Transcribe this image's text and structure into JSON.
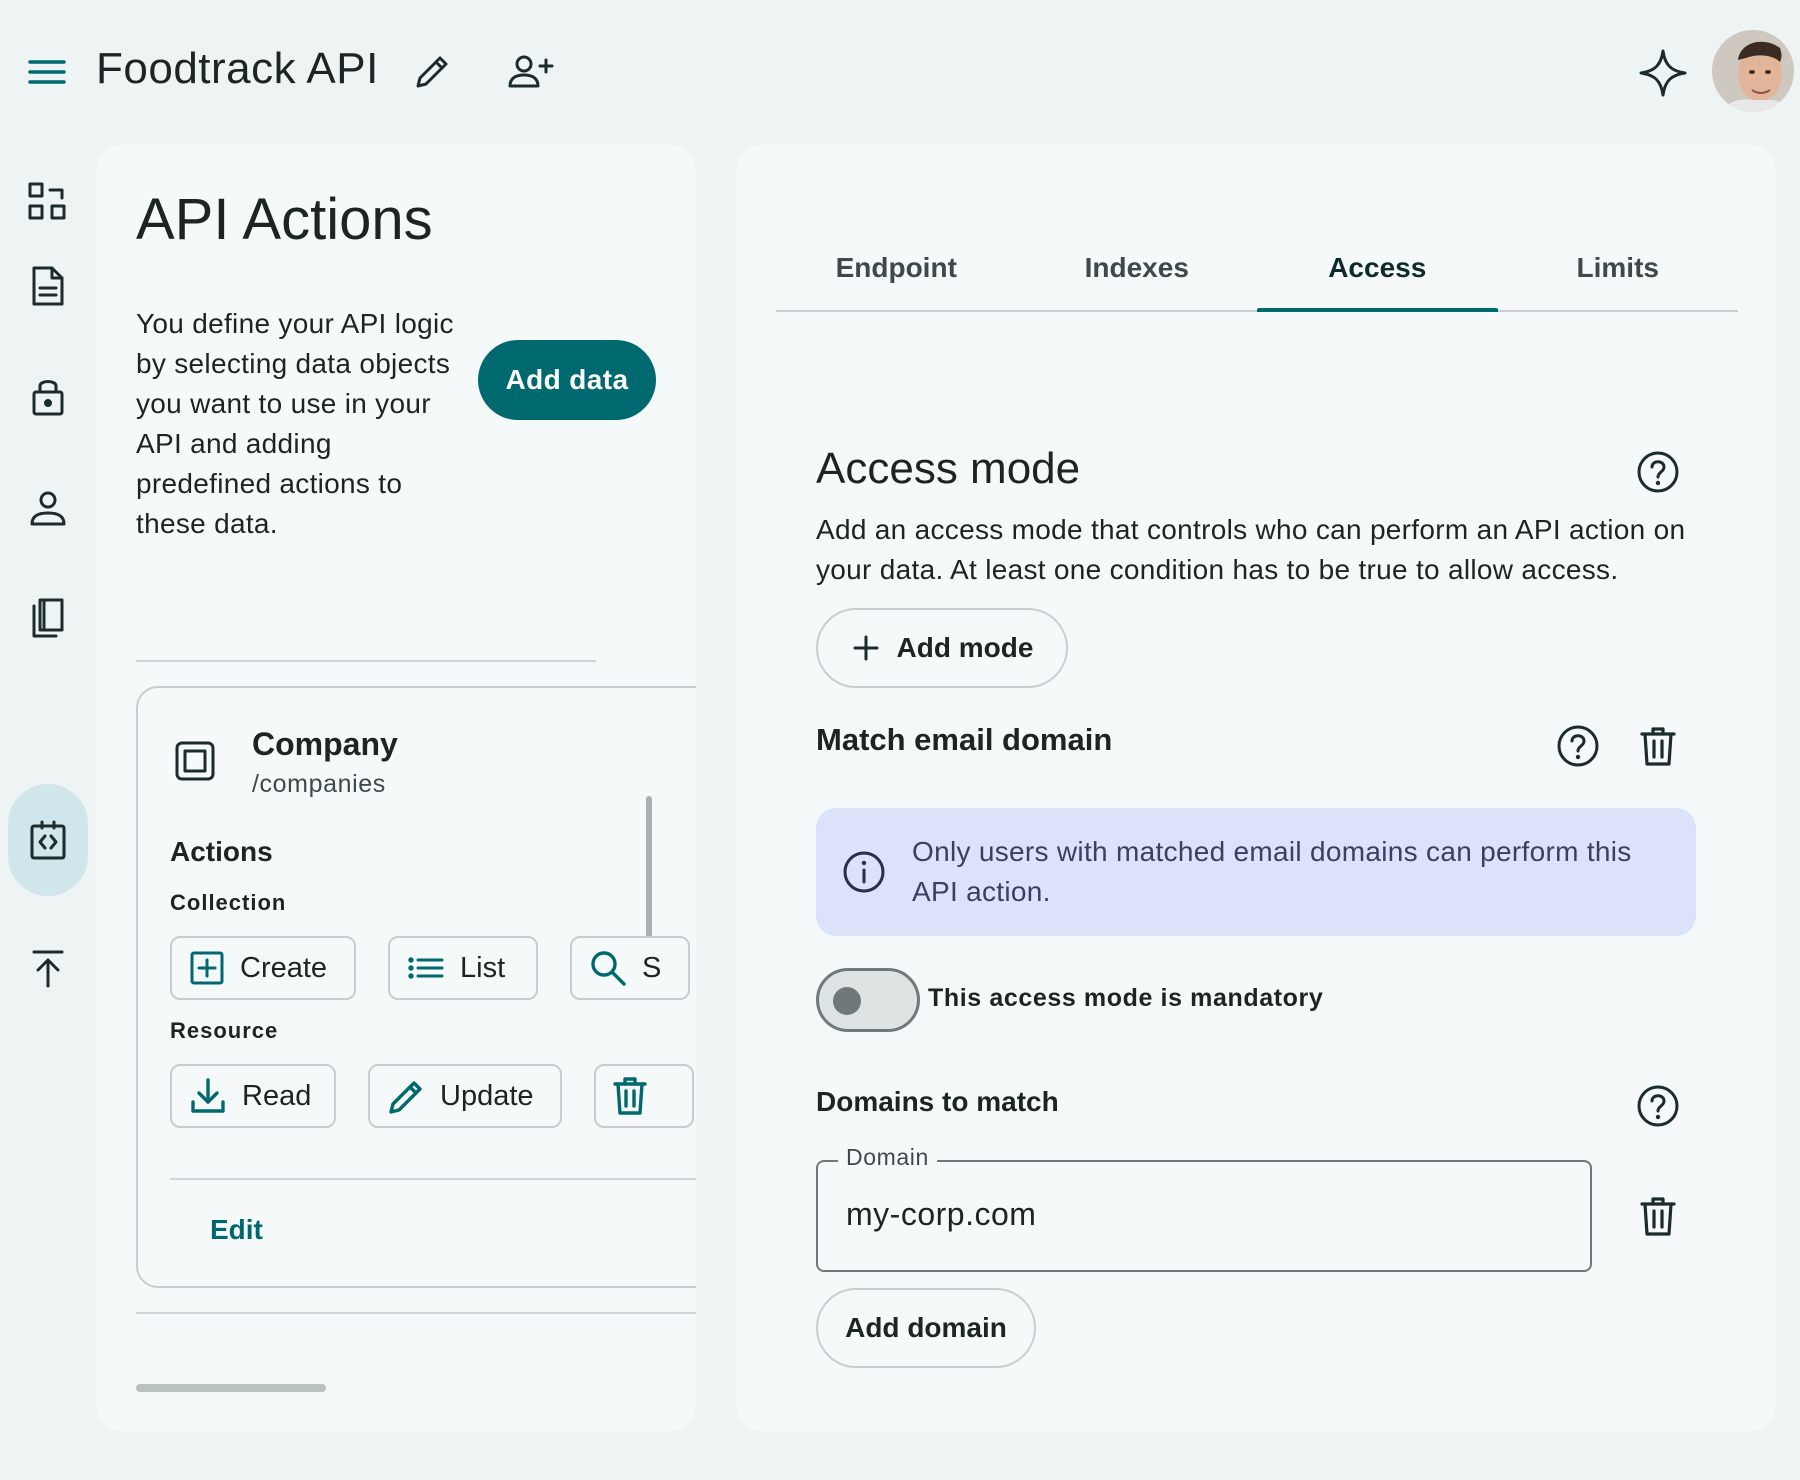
{
  "header": {
    "app_title": "Foodtrack API",
    "icons": [
      "menu-icon",
      "pencil-icon",
      "person-add-icon",
      "sparkle-icon",
      "avatar"
    ]
  },
  "rail": {
    "items": [
      {
        "icon": "dashboard-icon"
      },
      {
        "icon": "document-icon"
      },
      {
        "icon": "lock-icon"
      },
      {
        "icon": "person-icon"
      },
      {
        "icon": "book-icon"
      },
      {
        "icon": "api-code-icon",
        "active": true
      },
      {
        "icon": "publish-icon"
      }
    ]
  },
  "left_panel": {
    "title": "API Actions",
    "description": "You define your API logic by selecting data objects you want to use in your API and adding predefined actions to these data.",
    "add_data_label": "Add data",
    "card": {
      "name": "Company",
      "path": "/companies",
      "actions_heading": "Actions",
      "collection_heading": "Collection",
      "collection_actions": [
        {
          "label": "Create",
          "icon": "add-box-icon"
        },
        {
          "label": "List",
          "icon": "list-icon"
        },
        {
          "label": "S",
          "icon": "search-icon"
        }
      ],
      "resource_heading": "Resource",
      "resource_actions": [
        {
          "label": "Read",
          "icon": "download-icon"
        },
        {
          "label": "Update",
          "icon": "pencil-icon"
        },
        {
          "label": "",
          "icon": "trash-icon"
        }
      ],
      "edit_label": "Edit"
    }
  },
  "right_panel": {
    "tabs": [
      {
        "label": "Endpoint"
      },
      {
        "label": "Indexes"
      },
      {
        "label": "Access",
        "active": true
      },
      {
        "label": "Limits"
      }
    ],
    "access_mode": {
      "title": "Access mode",
      "description": "Add an access mode that controls who can perform an API action on your data. At least one condition has to be true to allow access.",
      "add_mode_label": "Add mode"
    },
    "match_email": {
      "title": "Match email domain",
      "info_text": "Only users with matched email domains can perform this API action.",
      "mandatory_toggle": {
        "label": "This access mode is mandatory",
        "checked": false
      },
      "domains_title": "Domains to match",
      "domain_field": {
        "label": "Domain",
        "value": "my-corp.com"
      },
      "add_domain_label": "Add domain"
    }
  },
  "colors": {
    "accent": "#00696f",
    "background": "#eef3f4",
    "panel": "#f5f9f9",
    "info_box": "#dbe2f9"
  }
}
